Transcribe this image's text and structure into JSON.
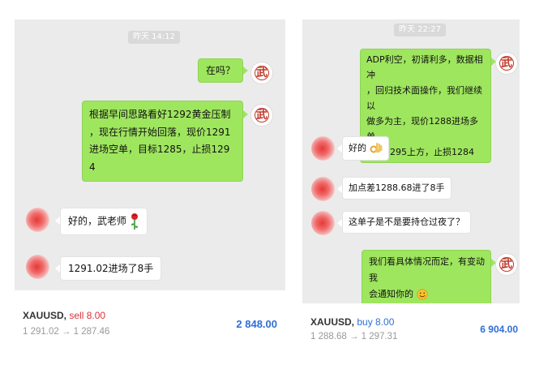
{
  "left_chat": {
    "timestamp": "昨天 14:12",
    "messages": [
      {
        "sender": "武",
        "side": "right",
        "text": "在吗？"
      },
      {
        "sender": "武",
        "side": "right",
        "lines": [
          "根据早间思路看好1292黄金压制",
          "，现在行情开始回落，现价1291",
          "进场空单，目标1285，止损129",
          "4"
        ]
      },
      {
        "sender": "user",
        "side": "left",
        "text": "好的，武老师"
      },
      {
        "sender": "user",
        "side": "left",
        "text": "1291.02进场了8手"
      }
    ]
  },
  "right_chat": {
    "timestamp": "昨天 22:27",
    "messages": [
      {
        "sender": "武",
        "side": "right",
        "lines": [
          "ADP利空，初请利多，数据相冲",
          "，回归技术面操作，我们继续以",
          "做多为主，现价1288进场多单，",
          "目标1295上方，止损1284"
        ]
      },
      {
        "sender": "user",
        "side": "left",
        "text": "好的"
      },
      {
        "sender": "user",
        "side": "left",
        "text": "加点差1288.68进了8手"
      },
      {
        "sender": "user",
        "side": "left",
        "text": "这单子是不是要持仓过夜了？"
      },
      {
        "sender": "武",
        "side": "right",
        "lines": [
          "我们看具体情况而定，有变动我",
          "会通知你的"
        ]
      }
    ]
  },
  "trade_left": {
    "symbol": "XAUUSD,",
    "action": "sell 8.00",
    "prices": "1 291.02 → 1 287.46",
    "profit": "2 848.00"
  },
  "trade_right": {
    "symbol": "XAUUSD,",
    "action": "buy 8.00",
    "prices": "1 288.68 → 1 297.31",
    "profit": "6 904.00"
  },
  "icons": {
    "rose": "rose-emoji",
    "ok_hand": "ok-hand-emoji",
    "smile": "smile-emoji"
  },
  "colors": {
    "bubble_green": "#9fe65f",
    "bubble_white": "#ffffff",
    "chat_bg": "#ebebeb",
    "sell": "#d6333a",
    "buy": "#2f6fd6",
    "profit": "#2f6fd6"
  }
}
